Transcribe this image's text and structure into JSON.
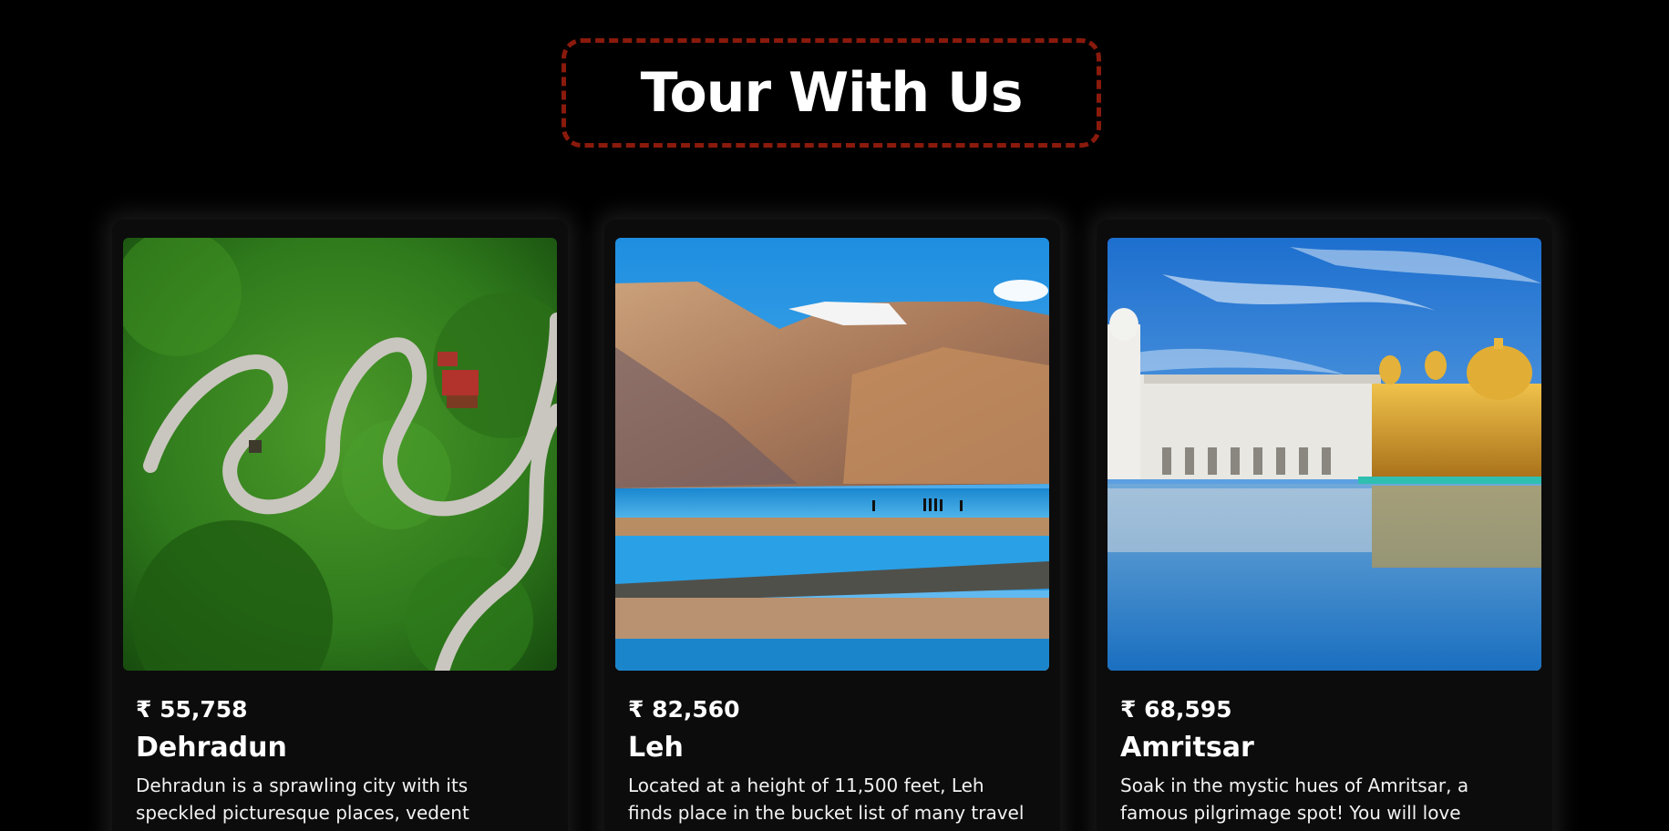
{
  "header": {
    "title": "Tour With Us"
  },
  "colors": {
    "background": "#000000",
    "title_border": "#8a1a0c",
    "card": "#0c0c0c"
  },
  "tours": [
    {
      "price": "₹ 55,758",
      "name": "Dehradun",
      "description": "Dehradun is a sprawling city with its speckled picturesque places, vedent",
      "image": "winding-mountain-road-photo"
    },
    {
      "price": "₹ 82,560",
      "name": "Leh",
      "description": "Located at a height of 11,500 feet, Leh finds place in the bucket list of many travel",
      "image": "mountain-lake-photo"
    },
    {
      "price": "₹ 68,595",
      "name": "Amritsar",
      "description": "Soak in the mystic hues of Amritsar, a famous pilgrimage spot! You will love",
      "image": "golden-temple-photo"
    }
  ]
}
